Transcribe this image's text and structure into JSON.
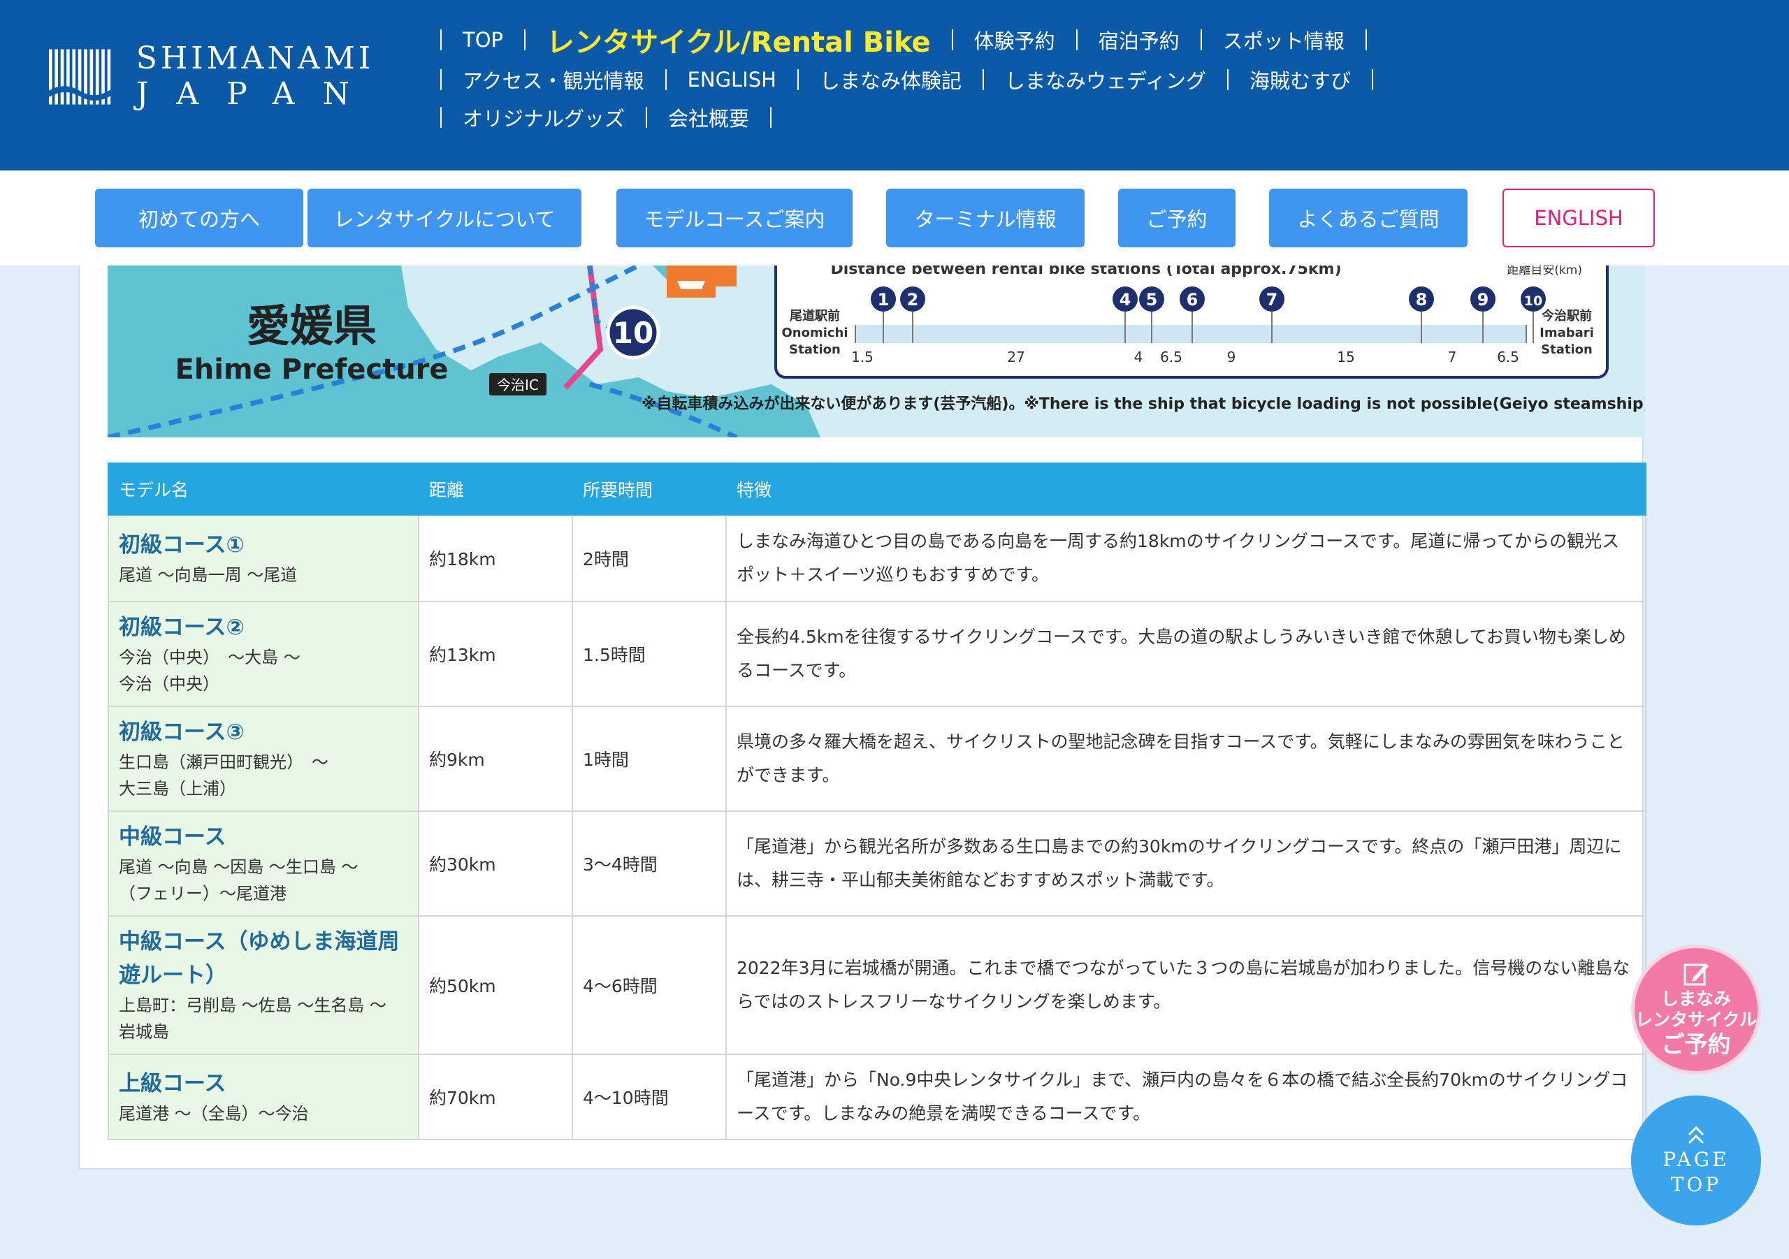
{
  "header": {
    "logo_line1": "SHIMANAMI",
    "logo_line2": "JAPAN",
    "nav_row1": [
      "TOP",
      "レンタサイクル/Rental Bike",
      "体験予約",
      "宿泊予約",
      "スポット情報"
    ],
    "nav_row2": [
      "アクセス・観光情報",
      "ENGLISH",
      "しまなみ体験記",
      "しまなみウェディング",
      "海賊むすび"
    ],
    "nav_row3": [
      "オリジナルグッズ",
      "会社概要"
    ]
  },
  "subnav": [
    "初めての方へ",
    "レンタサイクルについて",
    "モデルコースご案内",
    "ターミナル情報",
    "ご予約",
    "よくあるご質問",
    "ENGLISH"
  ],
  "map": {
    "pref_jp": "愛媛県",
    "pref_en": "Ehime Prefecture",
    "ic_label": "今治IC",
    "station_marker": "10",
    "distance_title": "Distance between rental bike stations (Total approx.75km)",
    "distance_unit": "距離目安(km)",
    "stations": [
      "1",
      "2",
      "4",
      "5",
      "6",
      "7",
      "8",
      "9",
      "10"
    ],
    "left_station_jp": "尾道駅前",
    "left_station_en1": "Onomichi",
    "left_station_en2": "Station",
    "right_station_jp": "今治駅前",
    "right_station_en1": "Imabari",
    "right_station_en2": "Station",
    "distances": [
      "1.5",
      "27",
      "4",
      "6.5",
      "9",
      "15",
      "7",
      "6.5"
    ],
    "note": "※自転車積み込みが出来ない便があります(芸予汽船)。※There is the ship that bicycle loading is not possible(Geiyo steamship)."
  },
  "table": {
    "headers": [
      "モデル名",
      "距離",
      "所要時間",
      "特徴"
    ],
    "rows": [
      {
        "name": "初級コース①",
        "route": "尾道 〜向島一周 〜尾道",
        "distance": "約18km",
        "time": "2時間",
        "feature": "しまなみ海道ひとつ目の島である向島を一周する約18kmのサイクリングコースです。尾道に帰ってからの観光スポット＋スイーツ巡りもおすすめです。"
      },
      {
        "name": "初級コース②",
        "route": "今治（中央）　〜大島 〜\n今治（中央）",
        "distance": "約13km",
        "time": "1.5時間",
        "feature": "全長約4.5kmを往復するサイクリングコースです。大島の道の駅よしうみいきいき館で休憩してお買い物も楽しめるコースです。"
      },
      {
        "name": "初級コース③",
        "route": "生口島（瀬戸田町観光）　〜\n大三島（上浦）",
        "distance": "約9km",
        "time": "1時間",
        "feature": "県境の多々羅大橋を超え、サイクリストの聖地記念碑を目指すコースです。気軽にしまなみの雰囲気を味わうことができます。"
      },
      {
        "name": "中級コース",
        "route": "尾道 〜向島 〜因島 〜生口島 〜\n（フェリー）〜尾道港",
        "distance": "約30km",
        "time": "3〜4時間",
        "feature": "「尾道港」から観光名所が多数ある生口島までの約30kmのサイクリングコースです。終点の「瀬戸田港」周辺には、耕三寺・平山郁夫美術館などおすすめスポット満載です。"
      },
      {
        "name": "中級コース（ゆめしま海道周遊ルート）",
        "route": "上島町：弓削島 〜佐島 〜生名島 〜\n岩城島",
        "distance": "約50km",
        "time": "4〜6時間",
        "feature": "2022年3月に岩城橋が開通。これまで橋でつながっていた３つの島に岩城島が加わりました。信号機のない離島ならではのストレスフリーなサイクリングを楽しめます。"
      },
      {
        "name": "上級コース",
        "route": "尾道港 〜（全島）〜今治",
        "distance": "約70km",
        "time": "4〜10時間",
        "feature": "「尾道港」から「No.9中央レンタサイクル」まで、瀬戸内の島々を６本の橋で結ぶ全長約70kmのサイクリングコースです。しまなみの絶景を満喫できるコースです。"
      }
    ]
  },
  "fab_reserve": {
    "line1": "しまなみ",
    "line2": "レンタサイクル",
    "line3": "ご予約"
  },
  "fab_top": {
    "line1": "PAGE",
    "line2": "TOP"
  },
  "colors": {
    "header_bg": "#0a5aa8",
    "highlight": "#ffea2e",
    "button_blue": "#3e96f0",
    "english_pink": "#e0207a",
    "table_header": "#24a6e0",
    "name_cell_bg": "#e8f7e6"
  }
}
